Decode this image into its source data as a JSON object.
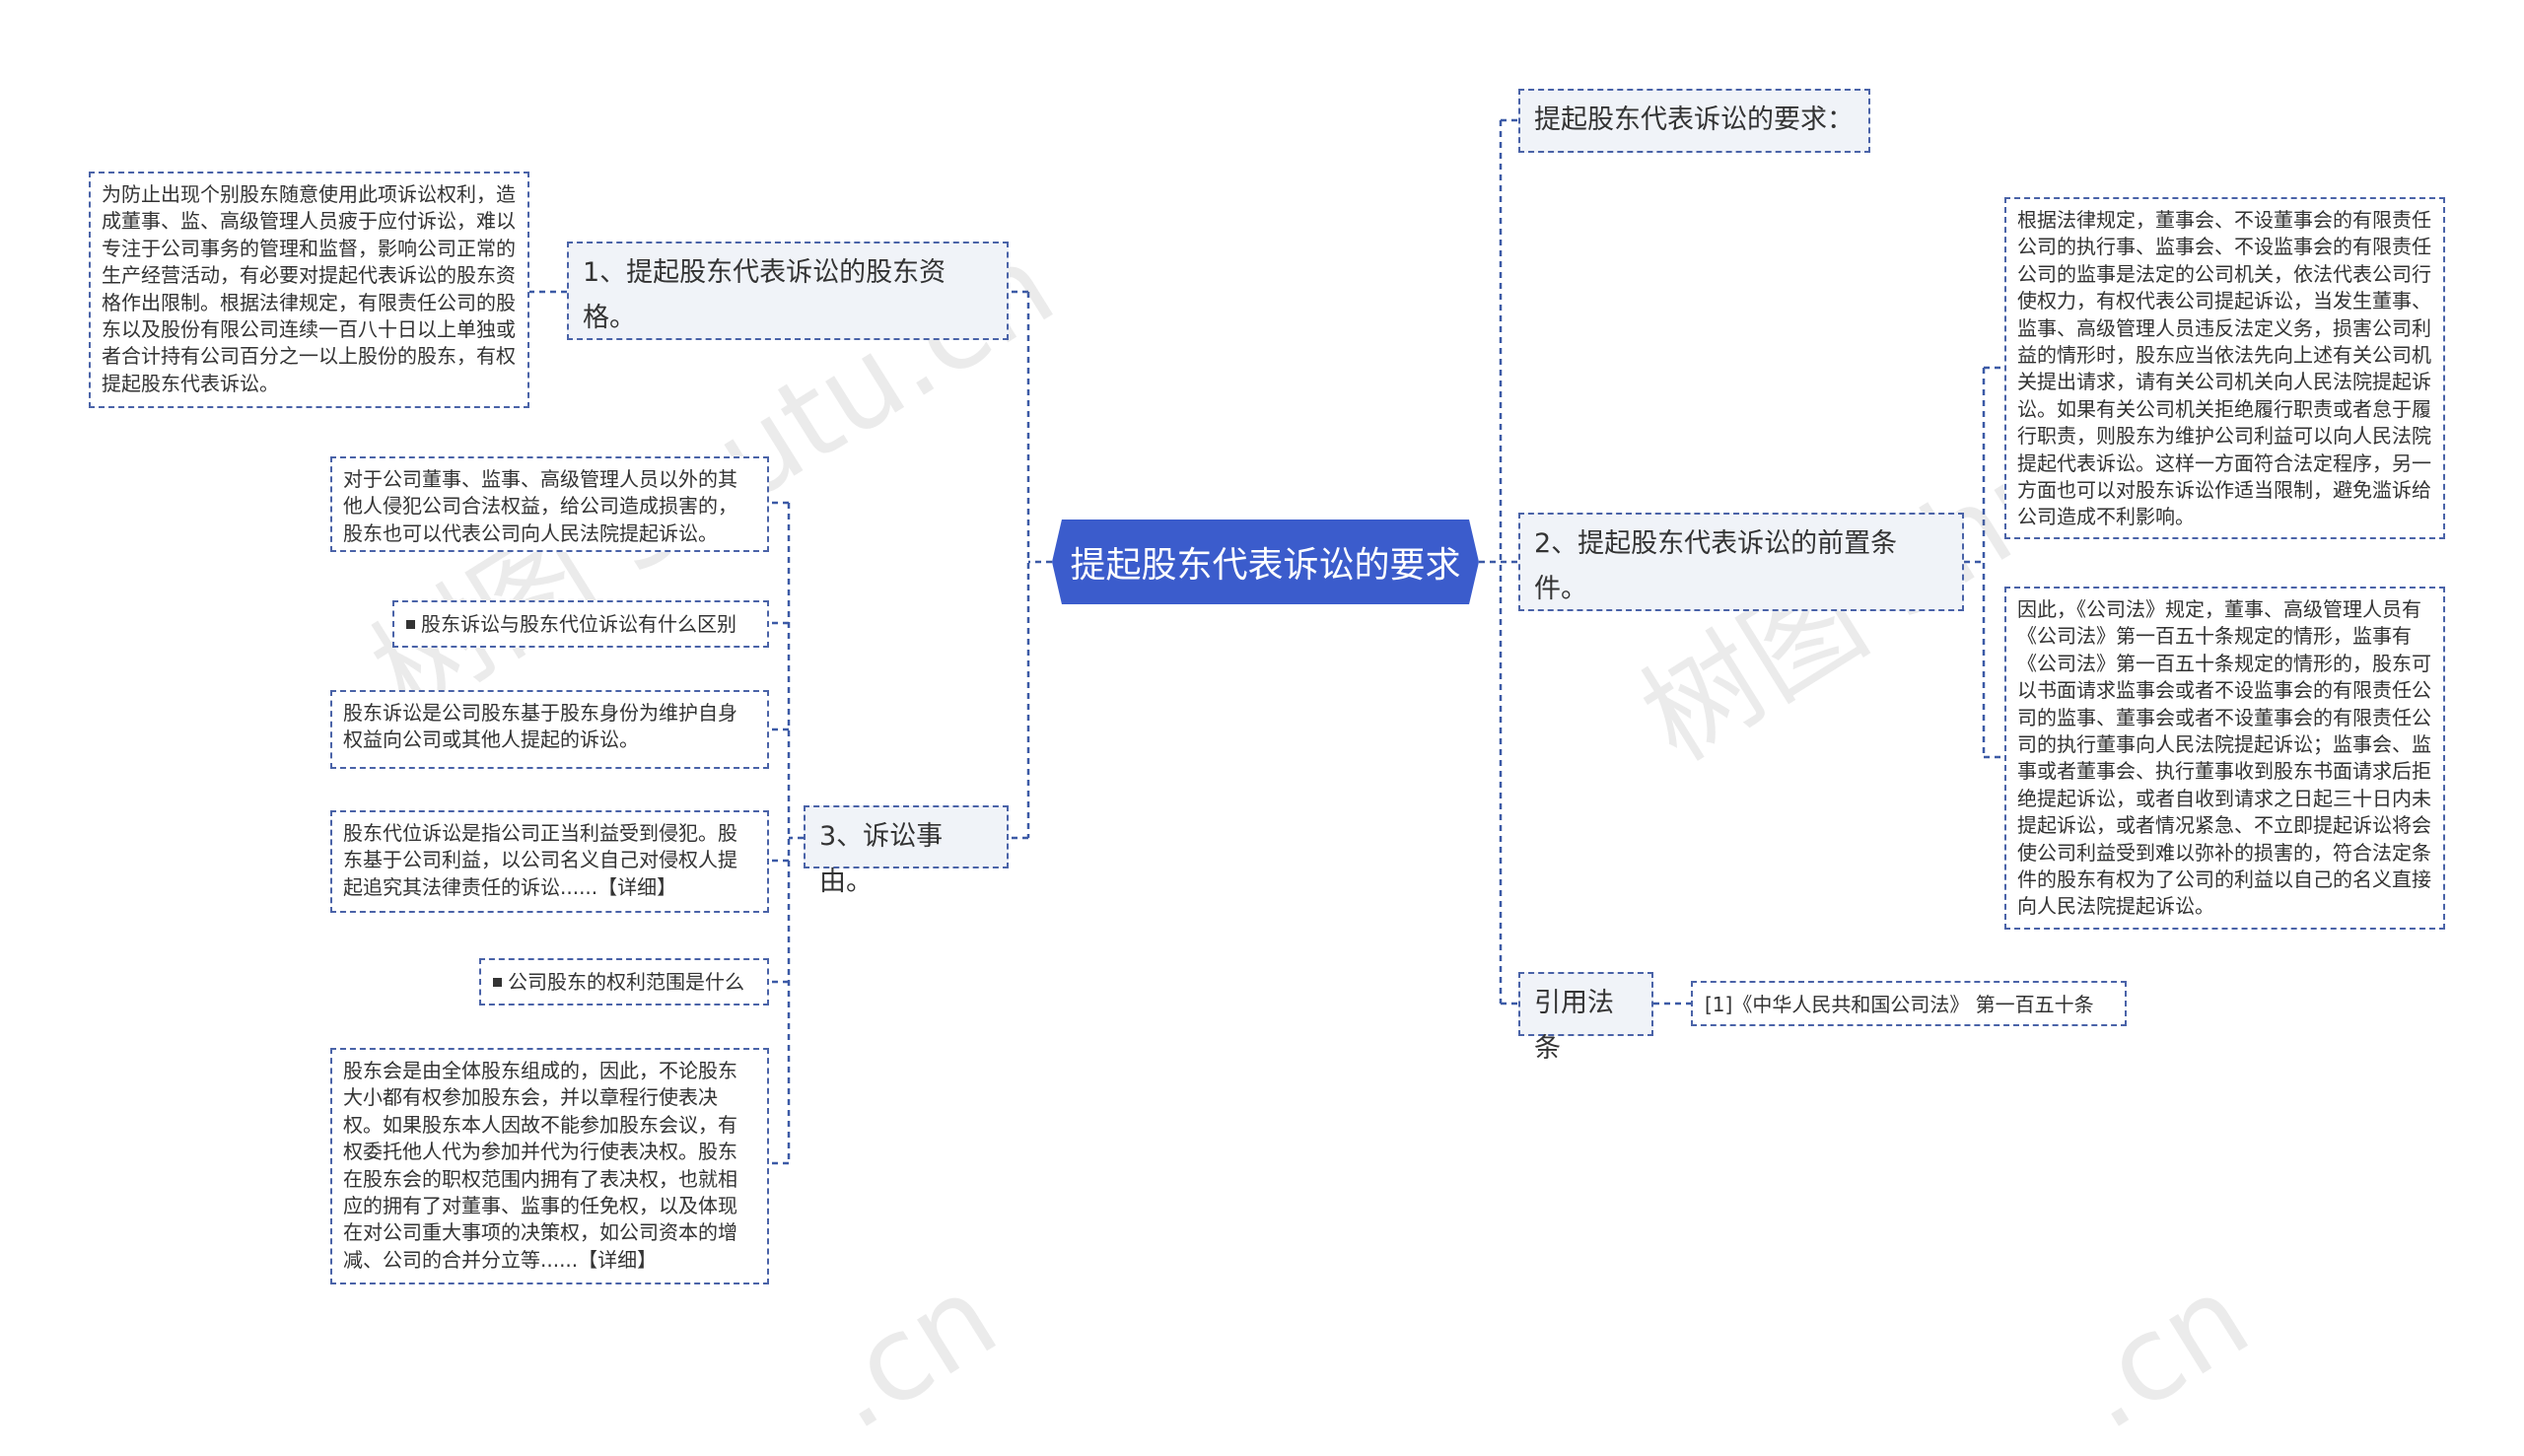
{
  "center": {
    "title": "提起股东代表诉讼的要求"
  },
  "left": {
    "qualification": {
      "title": "1、提起股东代表诉讼的股东资格。",
      "detail": "为防止出现个别股东随意使用此项诉讼权利，造成董事、监、高级管理人员疲于应付诉讼，难以专注于公司事务的管理和监督，影响公司正常的生产经营活动，有必要对提起代表诉讼的股东资格作出限制。根据法律规定，有限责任公司的股东以及股份有限公司连续一百八十日以上单独或者合计持有公司百分之一以上股份的股东，有权提起股东代表诉讼。"
    },
    "cause": {
      "title": "3、诉讼事由。",
      "items": {
        "intro": "对于公司董事、监事、高级管理人员以外的其他人侵犯公司合法权益，给公司造成损害的，股东也可以代表公司向人民法院提起诉讼。",
        "link1": "股东诉讼与股东代位诉讼有什么区别",
        "def1": "股东诉讼是公司股东基于股东身份为维护自身权益向公司或其他人提起的诉讼。",
        "def2": "股东代位诉讼是指公司正当利益受到侵犯。股东基于公司利益，以公司名义自己对侵权人提起追究其法律责任的诉讼......【详细】",
        "link2": "公司股东的权利范围是什么",
        "def3": "股东会是由全体股东组成的，因此，不论股东大小都有权参加股东会，并以章程行使表决权。如果股东本人因故不能参加股东会议，有权委托他人代为参加并代为行使表决权。股东在股东会的职权范围内拥有了表决权，也就相应的拥有了对董事、监事的任免权，以及体现在对公司重大事项的决策权，如公司资本的增减、公司的合并分立等......【详细】"
      }
    }
  },
  "right": {
    "requirements": {
      "title": "提起股东代表诉讼的要求："
    },
    "precondition": {
      "title": "2、提起股东代表诉讼的前置条件。",
      "detail1": "根据法律规定，董事会、不设董事会的有限责任公司的执行事、监事会、不设监事会的有限责任公司的监事是法定的公司机关，依法代表公司行使权力，有权代表公司提起诉讼，当发生董事、监事、高级管理人员违反法定义务，损害公司利益的情形时，股东应当依法先向上述有关公司机关提出请求，请有关公司机关向人民法院提起诉讼。如果有关公司机关拒绝履行职责或者怠于履行职责，则股东为维护公司利益可以向人民法院提起代表诉讼。这样一方面符合法定程序，另一方面也可以对股东诉讼作适当限制，避免滥诉给公司造成不利影响。",
      "detail2": "因此，《公司法》规定，董事、高级管理人员有《公司法》第一百五十条规定的情形，监事有《公司法》第一百五十条规定的情形的，股东可以书面请求监事会或者不设监事会的有限责任公司的监事、董事会或者不设董事会的有限责任公司的执行董事向人民法院提起诉讼；监事会、监事或者董事会、执行董事收到股东书面请求后拒绝提起诉讼，或者自收到请求之日起三十日内未提起诉讼，或者情况紧急、不立即提起诉讼将会使公司利益受到难以弥补的损害的，符合法定条件的股东有权为了公司的利益以自己的名义直接向人民法院提起诉讼。"
    },
    "law": {
      "title": "引用法条",
      "ref": "[1]《中华人民共和国公司法》 第一百五十条"
    }
  },
  "watermark": {
    "text1": "树图 shutu.cn",
    "text2": "树图 shutu",
    "text3": ".cn",
    "text4": ".cn"
  },
  "colors": {
    "center_fill": "#3b5ccc",
    "edge": "#3c5aa6",
    "border": "#4a63a8",
    "branch_fill": "#f0f3f8"
  }
}
